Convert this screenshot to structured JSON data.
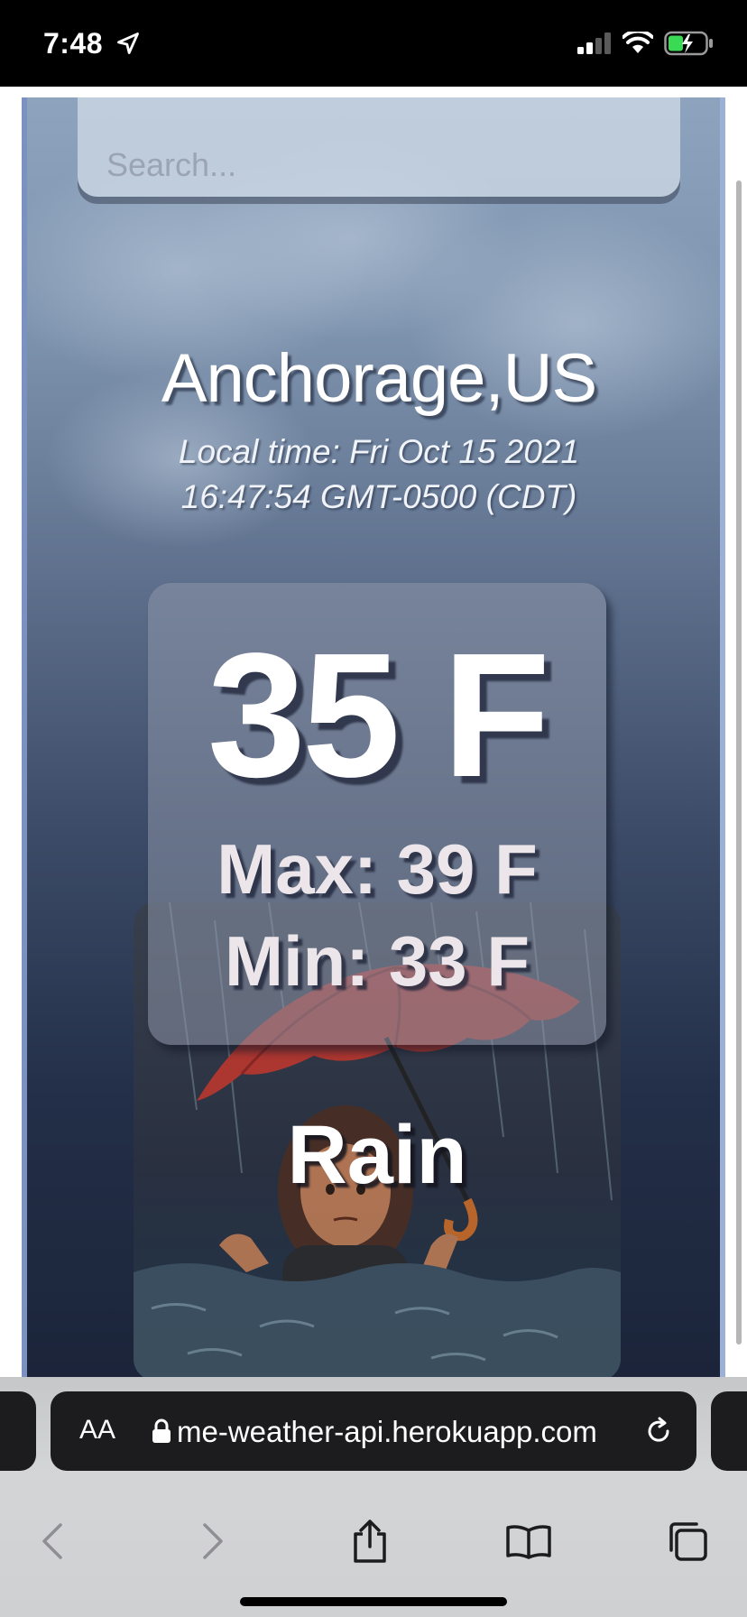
{
  "status_bar": {
    "time": "7:48",
    "icons": [
      "location-arrow-icon",
      "cellular-signal-icon",
      "wifi-icon",
      "battery-charging-icon"
    ]
  },
  "search": {
    "placeholder": "Search..."
  },
  "location": {
    "city": "Anchorage,US",
    "local_time": "Local time: Fri Oct 15 2021 16:47:54 GMT-0500 (CDT)"
  },
  "weather": {
    "temperature": "35 F",
    "max": "Max: 39 F",
    "min": "Min: 33 F",
    "condition": "Rain",
    "image_icon": "rain-umbrella-illustration"
  },
  "browser": {
    "text_size_button": "AA",
    "url": "me-weather-api.herokuapp.com",
    "nav_icons": [
      "back-icon",
      "forward-icon",
      "share-icon",
      "bookmarks-icon",
      "tabs-icon"
    ]
  },
  "colors": {
    "bg_top": "#8ea3bd",
    "bg_bottom": "#1b2439",
    "umbrella": "#b8372e",
    "chrome_bar": "#1c1c1e"
  }
}
